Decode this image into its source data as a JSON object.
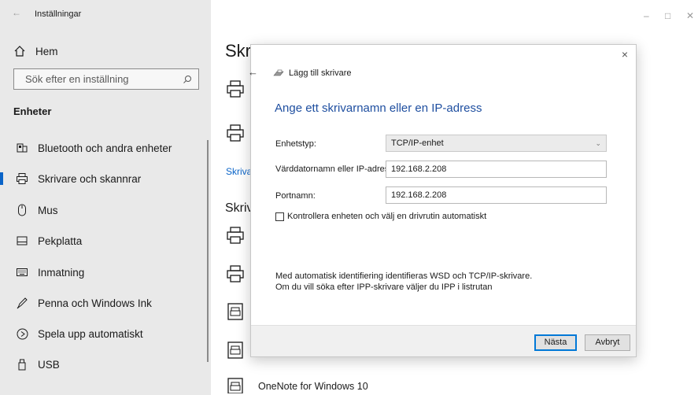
{
  "app": {
    "title": "Inställningar",
    "back_glyph": "←"
  },
  "sidebar": {
    "home": {
      "label": "Hem",
      "icon": "home-icon"
    },
    "search": {
      "placeholder": "Sök efter en inställning",
      "icon": "search-icon"
    },
    "section": "Enheter",
    "items": [
      {
        "label": "Bluetooth och andra enheter",
        "icon": "bluetooth-devices-icon"
      },
      {
        "label": "Skrivare och skannrar",
        "icon": "printer-icon",
        "active": true
      },
      {
        "label": "Mus",
        "icon": "mouse-icon"
      },
      {
        "label": "Pekplatta",
        "icon": "touchpad-icon"
      },
      {
        "label": "Inmatning",
        "icon": "keyboard-icon"
      },
      {
        "label": "Penna och Windows Ink",
        "icon": "pen-icon"
      },
      {
        "label": "Spela upp automatiskt",
        "icon": "autoplay-icon"
      },
      {
        "label": "USB",
        "icon": "usb-icon"
      }
    ]
  },
  "main": {
    "heading": "Skri",
    "link": "Skriva",
    "heading2": "Skriv",
    "last_item": "OneNote for Windows 10"
  },
  "window_controls": {
    "minimize": "–",
    "maximize": "□",
    "close": "✕"
  },
  "dialog": {
    "close_glyph": "×",
    "back_glyph": "←",
    "title": "Lägg till skrivare",
    "heading": "Ange ett skrivarnamn eller en IP-adress",
    "fields": {
      "device_type": {
        "label": "Enhetstyp:",
        "value": "TCP/IP-enhet"
      },
      "hostname": {
        "label": "Värddatornamn eller IP-adress:",
        "value": "192.168.2.208"
      },
      "port": {
        "label": "Portnamn:",
        "value": "192.168.2.208"
      }
    },
    "checkbox": {
      "label": "Kontrollera enheten och välj en drivrutin automatiskt",
      "checked": false
    },
    "info_line1": "Med automatisk identifiering identifieras WSD och TCP/IP-skrivare.",
    "info_line2": "Om du vill söka efter IPP-skrivare väljer du IPP i listrutan",
    "buttons": {
      "next": "Nästa",
      "cancel": "Avbryt"
    }
  },
  "colors": {
    "accent": "#0a64c8",
    "sidebar_bg": "#e9e9e9",
    "dialog_heading": "#1f4fa0"
  }
}
